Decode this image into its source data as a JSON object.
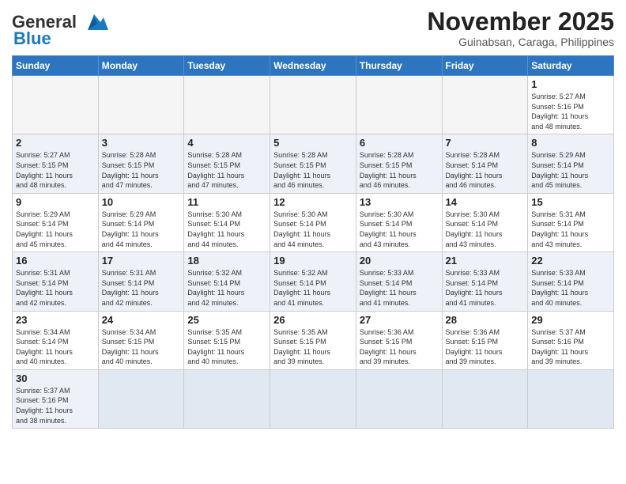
{
  "logo": {
    "line1": "General",
    "line2": "Blue"
  },
  "title": "November 2025",
  "subtitle": "Guinabsan, Caraga, Philippines",
  "weekdays": [
    "Sunday",
    "Monday",
    "Tuesday",
    "Wednesday",
    "Thursday",
    "Friday",
    "Saturday"
  ],
  "weeks": [
    [
      {
        "day": "",
        "info": ""
      },
      {
        "day": "",
        "info": ""
      },
      {
        "day": "",
        "info": ""
      },
      {
        "day": "",
        "info": ""
      },
      {
        "day": "",
        "info": ""
      },
      {
        "day": "",
        "info": ""
      },
      {
        "day": "1",
        "info": "Sunrise: 5:27 AM\nSunset: 5:16 PM\nDaylight: 11 hours\nand 48 minutes."
      }
    ],
    [
      {
        "day": "2",
        "info": "Sunrise: 5:27 AM\nSunset: 5:15 PM\nDaylight: 11 hours\nand 48 minutes."
      },
      {
        "day": "3",
        "info": "Sunrise: 5:28 AM\nSunset: 5:15 PM\nDaylight: 11 hours\nand 47 minutes."
      },
      {
        "day": "4",
        "info": "Sunrise: 5:28 AM\nSunset: 5:15 PM\nDaylight: 11 hours\nand 47 minutes."
      },
      {
        "day": "5",
        "info": "Sunrise: 5:28 AM\nSunset: 5:15 PM\nDaylight: 11 hours\nand 46 minutes."
      },
      {
        "day": "6",
        "info": "Sunrise: 5:28 AM\nSunset: 5:15 PM\nDaylight: 11 hours\nand 46 minutes."
      },
      {
        "day": "7",
        "info": "Sunrise: 5:28 AM\nSunset: 5:14 PM\nDaylight: 11 hours\nand 46 minutes."
      },
      {
        "day": "8",
        "info": "Sunrise: 5:29 AM\nSunset: 5:14 PM\nDaylight: 11 hours\nand 45 minutes."
      }
    ],
    [
      {
        "day": "9",
        "info": "Sunrise: 5:29 AM\nSunset: 5:14 PM\nDaylight: 11 hours\nand 45 minutes."
      },
      {
        "day": "10",
        "info": "Sunrise: 5:29 AM\nSunset: 5:14 PM\nDaylight: 11 hours\nand 44 minutes."
      },
      {
        "day": "11",
        "info": "Sunrise: 5:30 AM\nSunset: 5:14 PM\nDaylight: 11 hours\nand 44 minutes."
      },
      {
        "day": "12",
        "info": "Sunrise: 5:30 AM\nSunset: 5:14 PM\nDaylight: 11 hours\nand 44 minutes."
      },
      {
        "day": "13",
        "info": "Sunrise: 5:30 AM\nSunset: 5:14 PM\nDaylight: 11 hours\nand 43 minutes."
      },
      {
        "day": "14",
        "info": "Sunrise: 5:30 AM\nSunset: 5:14 PM\nDaylight: 11 hours\nand 43 minutes."
      },
      {
        "day": "15",
        "info": "Sunrise: 5:31 AM\nSunset: 5:14 PM\nDaylight: 11 hours\nand 43 minutes."
      }
    ],
    [
      {
        "day": "16",
        "info": "Sunrise: 5:31 AM\nSunset: 5:14 PM\nDaylight: 11 hours\nand 42 minutes."
      },
      {
        "day": "17",
        "info": "Sunrise: 5:31 AM\nSunset: 5:14 PM\nDaylight: 11 hours\nand 42 minutes."
      },
      {
        "day": "18",
        "info": "Sunrise: 5:32 AM\nSunset: 5:14 PM\nDaylight: 11 hours\nand 42 minutes."
      },
      {
        "day": "19",
        "info": "Sunrise: 5:32 AM\nSunset: 5:14 PM\nDaylight: 11 hours\nand 41 minutes."
      },
      {
        "day": "20",
        "info": "Sunrise: 5:33 AM\nSunset: 5:14 PM\nDaylight: 11 hours\nand 41 minutes."
      },
      {
        "day": "21",
        "info": "Sunrise: 5:33 AM\nSunset: 5:14 PM\nDaylight: 11 hours\nand 41 minutes."
      },
      {
        "day": "22",
        "info": "Sunrise: 5:33 AM\nSunset: 5:14 PM\nDaylight: 11 hours\nand 40 minutes."
      }
    ],
    [
      {
        "day": "23",
        "info": "Sunrise: 5:34 AM\nSunset: 5:14 PM\nDaylight: 11 hours\nand 40 minutes."
      },
      {
        "day": "24",
        "info": "Sunrise: 5:34 AM\nSunset: 5:15 PM\nDaylight: 11 hours\nand 40 minutes."
      },
      {
        "day": "25",
        "info": "Sunrise: 5:35 AM\nSunset: 5:15 PM\nDaylight: 11 hours\nand 40 minutes."
      },
      {
        "day": "26",
        "info": "Sunrise: 5:35 AM\nSunset: 5:15 PM\nDaylight: 11 hours\nand 39 minutes."
      },
      {
        "day": "27",
        "info": "Sunrise: 5:36 AM\nSunset: 5:15 PM\nDaylight: 11 hours\nand 39 minutes."
      },
      {
        "day": "28",
        "info": "Sunrise: 5:36 AM\nSunset: 5:15 PM\nDaylight: 11 hours\nand 39 minutes."
      },
      {
        "day": "29",
        "info": "Sunrise: 5:37 AM\nSunset: 5:16 PM\nDaylight: 11 hours\nand 39 minutes."
      }
    ],
    [
      {
        "day": "30",
        "info": "Sunrise: 5:37 AM\nSunset: 5:16 PM\nDaylight: 11 hours\nand 38 minutes."
      },
      {
        "day": "",
        "info": ""
      },
      {
        "day": "",
        "info": ""
      },
      {
        "day": "",
        "info": ""
      },
      {
        "day": "",
        "info": ""
      },
      {
        "day": "",
        "info": ""
      },
      {
        "day": "",
        "info": ""
      }
    ]
  ]
}
